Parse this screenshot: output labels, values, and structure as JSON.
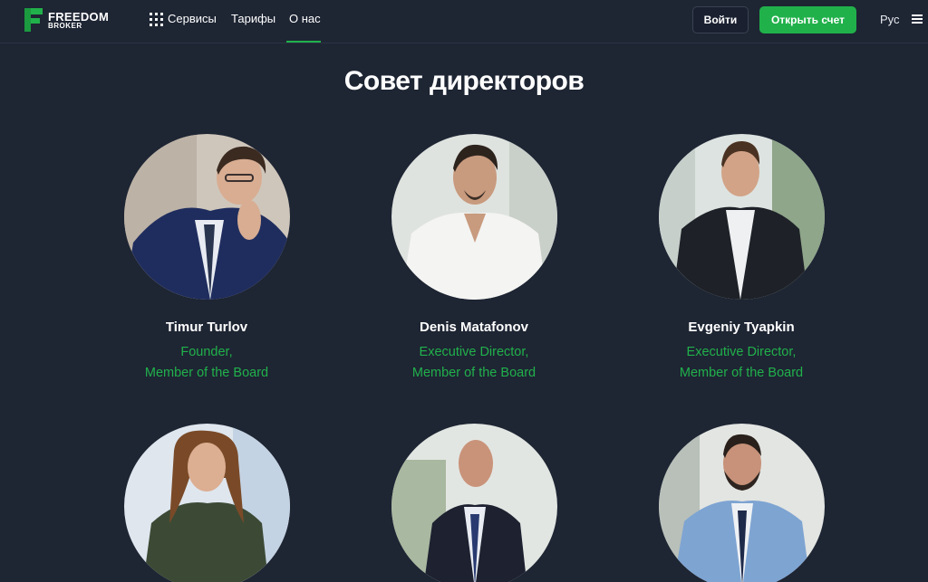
{
  "header": {
    "logo_line1": "FREEDOM",
    "logo_line2": "BROKER",
    "nav": [
      {
        "label": "Сервисы",
        "icon": "grid-icon"
      },
      {
        "label": "Тарифы"
      },
      {
        "label": "О нас",
        "active": true
      }
    ],
    "login_label": "Войти",
    "open_account_label": "Открыть счет",
    "language": "Рус",
    "menu_icon": "hamburger-icon"
  },
  "colors": {
    "background": "#1e2533",
    "accent": "#21b14b",
    "text": "#ffffff"
  },
  "main": {
    "title": "Совет директоров",
    "directors": [
      {
        "name": "Timur Turlov",
        "role_line1": "Founder,",
        "role_line2": "Member of the Board"
      },
      {
        "name": "Denis Matafonov",
        "role_line1": "Executive Director,",
        "role_line2": "Member of the Board"
      },
      {
        "name": "Evgeniy Tyapkin",
        "role_line1": "Executive Director,",
        "role_line2": "Member of the Board"
      },
      {
        "name": "",
        "role_line1": "",
        "role_line2": ""
      },
      {
        "name": "",
        "role_line1": "",
        "role_line2": ""
      },
      {
        "name": "",
        "role_line1": "",
        "role_line2": ""
      }
    ]
  }
}
